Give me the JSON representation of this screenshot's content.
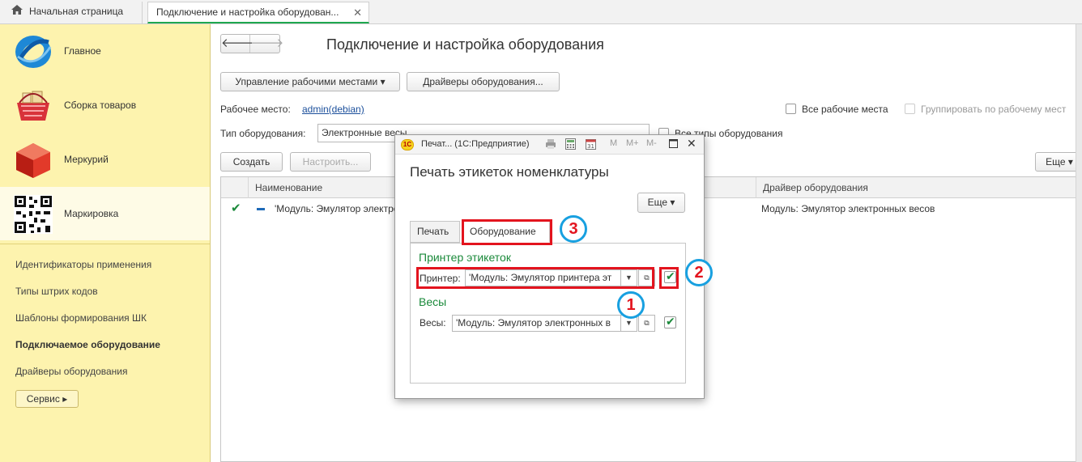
{
  "tabs": {
    "home_label": "Начальная страница",
    "active_label": "Подключение и настройка оборудован...",
    "close_glyph": "✕"
  },
  "sidebar": {
    "sections": [
      {
        "label": "Главное"
      },
      {
        "label": "Сборка товаров"
      },
      {
        "label": "Меркурий"
      },
      {
        "label": "Маркировка"
      }
    ],
    "links": [
      {
        "label": "Идентификаторы применения"
      },
      {
        "label": "Типы штрих кодов"
      },
      {
        "label": "Шаблоны формирования ШК"
      },
      {
        "label": "Подключаемое оборудование"
      },
      {
        "label": "Драйверы оборудования"
      }
    ],
    "service_button": "Сервис ▸"
  },
  "main": {
    "nav_back": "🡐",
    "nav_forward": "🡒",
    "title": "Подключение и настройка оборудования",
    "workplaces_button": "Управление рабочими местами ▾",
    "drivers_button": "Драйверы оборудования...",
    "workplace_label": "Рабочее место:",
    "workplace_value": "admin(debian)",
    "all_workplaces": "Все рабочие места",
    "group_by_workplace": "Группировать по рабочему мест",
    "equipment_type_label": "Тип оборудования:",
    "equipment_type_value": "Электронные весы",
    "all_types": "Все типы оборудования",
    "create_button": "Создать",
    "configure_button": "Настроить...",
    "more_button": "Еще ▾",
    "table": {
      "headers": [
        "Наименование",
        "Драйвер оборудования"
      ],
      "rows": [
        {
          "name": "'Модуль: Эмулятор электронных весов",
          "driver": "Модуль: Эмулятор электронных весов"
        }
      ],
      "check_glyph": "✔",
      "row_marker": "▬"
    }
  },
  "dialog": {
    "title": "Печат... (1С:Предприятие)",
    "logo_text": "1С",
    "toolbar": [
      "M",
      "M+",
      "M-"
    ],
    "heading": "Печать этикеток номенклатуры",
    "more_button": "Еще ▾",
    "tabs": [
      "Печать",
      "Оборудование"
    ],
    "printer_group": "Принтер  этикеток",
    "printer_label": "Принтер:",
    "printer_value": "'Модуль: Эмулятор принтера эт",
    "scales_group": "Весы",
    "scales_label": "Весы:",
    "scales_value": "'Модуль: Эмулятор электронных в",
    "dropdown_glyph": "▼",
    "open_glyph": "⧉",
    "check_glyph": "✔"
  },
  "annotations": {
    "badge1": "1",
    "badge2": "2",
    "badge3": "3",
    "accent_red": "#e3141e",
    "accent_blue": "#18a0e0"
  }
}
